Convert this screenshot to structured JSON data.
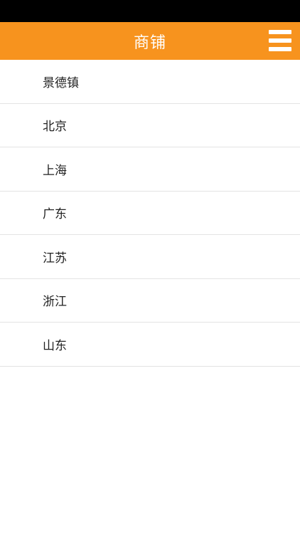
{
  "header": {
    "title": "商铺",
    "menu_icon": "hamburger-menu-icon",
    "background_color": "#f7931e"
  },
  "list": {
    "items": [
      {
        "label": "景德镇"
      },
      {
        "label": "北京"
      },
      {
        "label": "上海"
      },
      {
        "label": "广东"
      },
      {
        "label": "江苏"
      },
      {
        "label": "浙江"
      },
      {
        "label": "山东"
      }
    ]
  }
}
